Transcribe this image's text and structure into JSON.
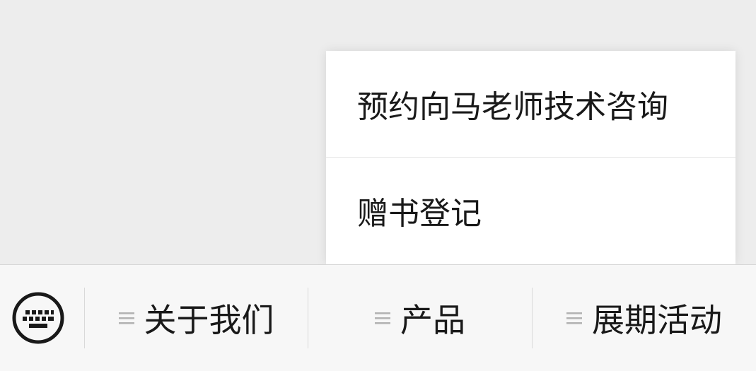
{
  "popup": {
    "items": [
      {
        "label": "预约向马老师技术咨询"
      },
      {
        "label": "赠书登记"
      }
    ]
  },
  "menu_bar": {
    "keyboard_icon": "keyboard-icon",
    "items": [
      {
        "label": "关于我们",
        "icon": "submenu-icon"
      },
      {
        "label": "产品",
        "icon": "submenu-icon"
      },
      {
        "label": "展期活动",
        "icon": "submenu-icon"
      }
    ]
  },
  "colors": {
    "background": "#ededed",
    "popup_background": "#ffffff",
    "menu_bar_background": "#f7f7f7",
    "text": "#191919",
    "hamburger": "#b2b2b2"
  }
}
